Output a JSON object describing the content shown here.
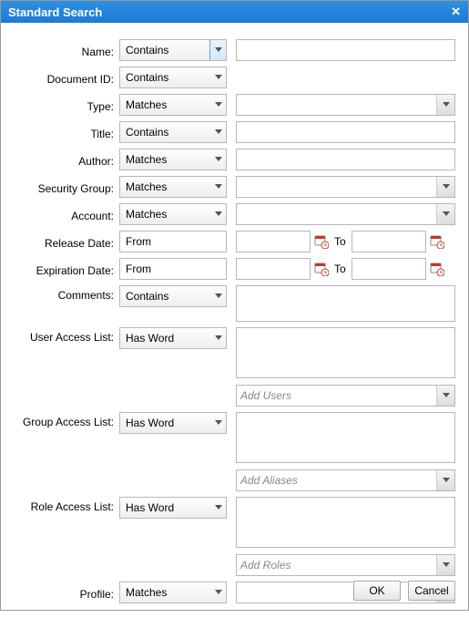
{
  "title": "Standard Search",
  "labels": {
    "name": "Name:",
    "docid": "Document ID:",
    "type": "Type:",
    "title_f": "Title:",
    "author": "Author:",
    "secgroup": "Security Group:",
    "account": "Account:",
    "reldate": "Release Date:",
    "expdate": "Expiration Date:",
    "comments": "Comments:",
    "ual": "User Access List:",
    "gal": "Group Access List:",
    "ral": "Role Access List:",
    "profile": "Profile:",
    "to": "To"
  },
  "ops": {
    "name": "Contains",
    "docid": "Contains",
    "type": "Matches",
    "title_f": "Contains",
    "author": "Matches",
    "secgroup": "Matches",
    "account": "Matches",
    "reldate": "From",
    "expdate": "From",
    "comments": "Contains",
    "ual": "Has Word",
    "gal": "Has Word",
    "ral": "Has Word",
    "profile": "Matches"
  },
  "placeholders": {
    "addUsers": "Add Users",
    "addAliases": "Add Aliases",
    "addRoles": "Add Roles"
  },
  "buttons": {
    "ok": "OK",
    "cancel": "Cancel"
  }
}
